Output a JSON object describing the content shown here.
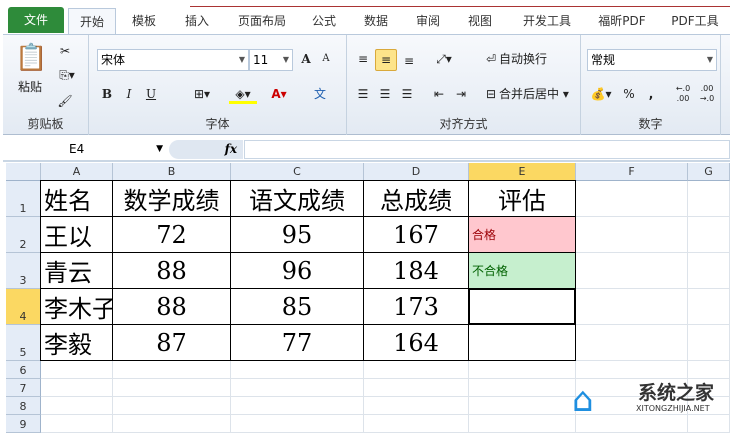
{
  "tabs": [
    "文件",
    "开始",
    "模板",
    "插入",
    "页面布局",
    "公式",
    "数据",
    "审阅",
    "视图",
    "开发工具",
    "福昕PDF",
    "PDF工具"
  ],
  "clipboard": {
    "paste": "粘贴",
    "label": "剪贴板"
  },
  "font": {
    "name": "宋体",
    "size": "11",
    "bold": "B",
    "italic": "I",
    "underline": "U",
    "label": "字体",
    "grow": "A",
    "shrink": "A",
    "phonetic": "文"
  },
  "align": {
    "wrap": "自动换行",
    "merge": "合并后居中",
    "label": "对齐方式"
  },
  "number": {
    "format": "常规",
    "percent": "%",
    "comma": ",",
    "label": "数字"
  },
  "formula_bar": {
    "name_box": "E4",
    "fx": "fx",
    "value": ""
  },
  "columns": [
    "A",
    "B",
    "C",
    "D",
    "E",
    "F",
    "G"
  ],
  "rows": [
    "1",
    "2",
    "3",
    "4",
    "5",
    "6",
    "7",
    "8",
    "9"
  ],
  "table": [
    [
      "姓名",
      "数学成绩",
      "语文成绩",
      "总成绩",
      "评估"
    ],
    [
      "王以",
      "72",
      "95",
      "167",
      "合格"
    ],
    [
      "青云",
      "88",
      "96",
      "184",
      "不合格"
    ],
    [
      "李木子",
      "88",
      "85",
      "173",
      ""
    ],
    [
      "李毅",
      "87",
      "77",
      "164",
      ""
    ]
  ],
  "watermark": {
    "title": "系统之家",
    "url": "XITONGZHIJIA.NET"
  },
  "colors": {
    "pass_bg": "#ffc7ce",
    "pass_fg": "#9c0006",
    "fail_bg": "#c6efce",
    "fail_fg": "#006100",
    "selected_header": "#fbd862"
  }
}
